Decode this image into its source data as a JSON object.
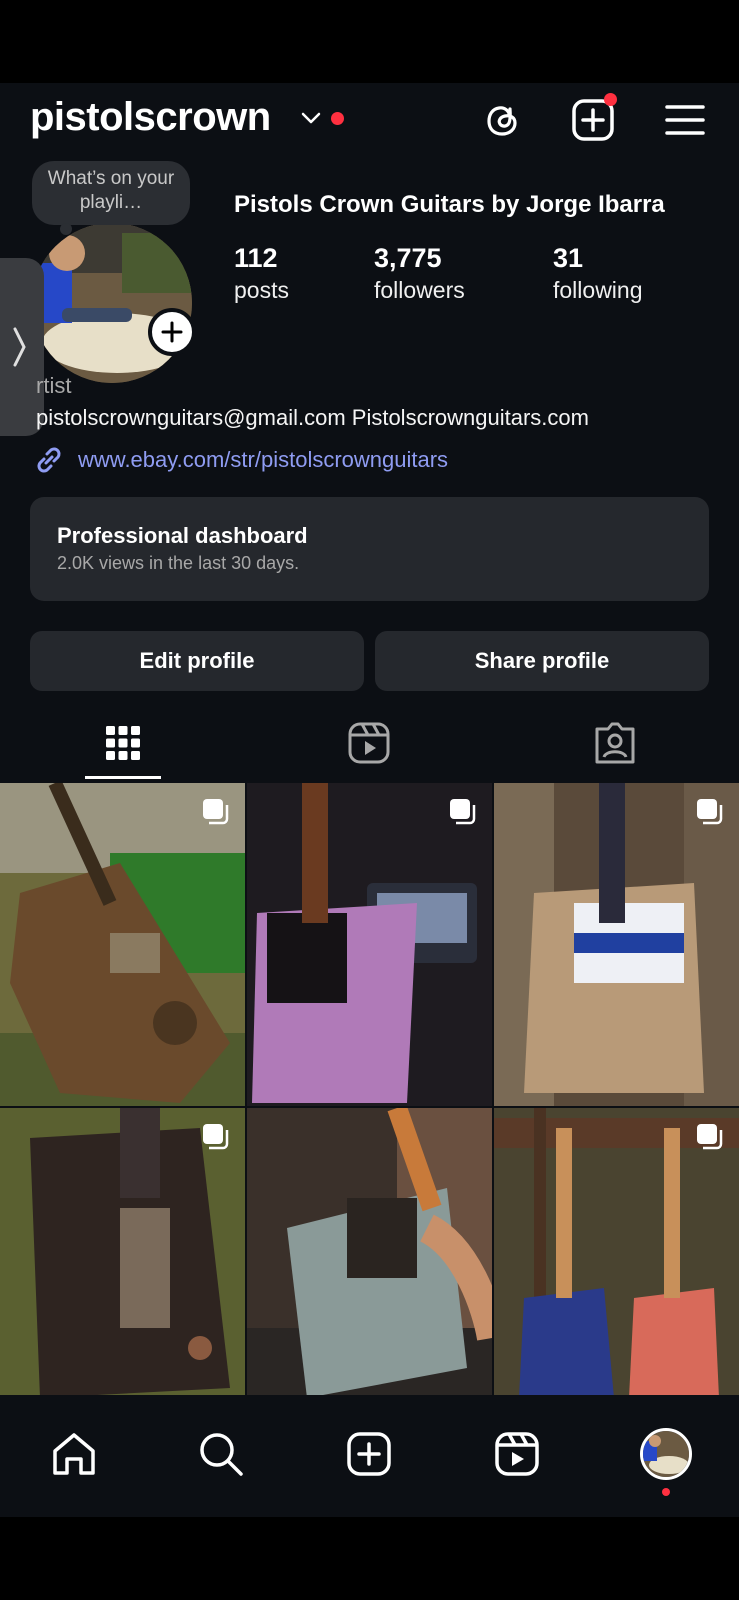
{
  "header": {
    "username": "pistolscrown",
    "icons": [
      "chevron-down-icon",
      "threads-icon",
      "create-post-icon",
      "menu-icon"
    ]
  },
  "profile": {
    "note": "What’s on your playli…",
    "full_name": "Pistols Crown Guitars by Jorge Ibarra",
    "stats": [
      {
        "num": "112",
        "label": "posts"
      },
      {
        "num": "3,775",
        "label": "followers"
      },
      {
        "num": "31",
        "label": "following"
      }
    ],
    "category": "rtist",
    "bio": "pistolscrownguitars@gmail.com Pistolscrownguitars.com",
    "link": "www.ebay.com/str/pistolscrownguitars"
  },
  "dashboard": {
    "title": "Professional dashboard",
    "subtitle": "2.0K views in the last 30 days."
  },
  "buttons": {
    "edit": "Edit profile",
    "share": "Share profile"
  },
  "tabs": [
    "grid-icon",
    "reels-icon",
    "tagged-icon"
  ],
  "posts": [
    {
      "desc": "rusted telecaster on hay"
    },
    {
      "desc": "purple telecaster with mixer"
    },
    {
      "desc": "license plate telecaster"
    },
    {
      "desc": "rusted stratocaster on grass"
    },
    {
      "desc": "grey telecaster held"
    },
    {
      "desc": "two telecasters on fence"
    }
  ],
  "nav": [
    "home-icon",
    "search-icon",
    "create-icon",
    "reels-icon",
    "profile-avatar"
  ],
  "colors": {
    "background": "#0c0f14",
    "card": "#25282d",
    "accent_red": "#ff3040",
    "link": "#8f9cf2"
  }
}
